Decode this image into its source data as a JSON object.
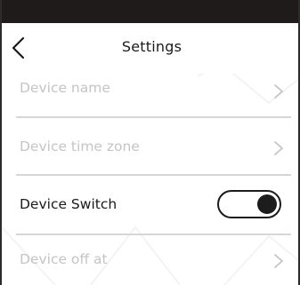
{
  "header": {
    "title": "Settings",
    "back_icon": "chevron-left-icon"
  },
  "settings": {
    "device_name": {
      "label": "Device name",
      "icon": "chevron-right-icon"
    },
    "device_time_zone": {
      "label": "Device time zone",
      "icon": "chevron-right-icon"
    },
    "device_switch": {
      "label": "Device Switch",
      "enabled": true
    },
    "device_off_at": {
      "label": "Device off at",
      "icon": "chevron-right-icon"
    }
  },
  "colors": {
    "status_bar": "#1f1b1b",
    "text_primary": "#1a1a1a",
    "text_disabled": "#c4c4c4",
    "divider": "#d6d6d6",
    "toggle": "#1c1c1c"
  }
}
